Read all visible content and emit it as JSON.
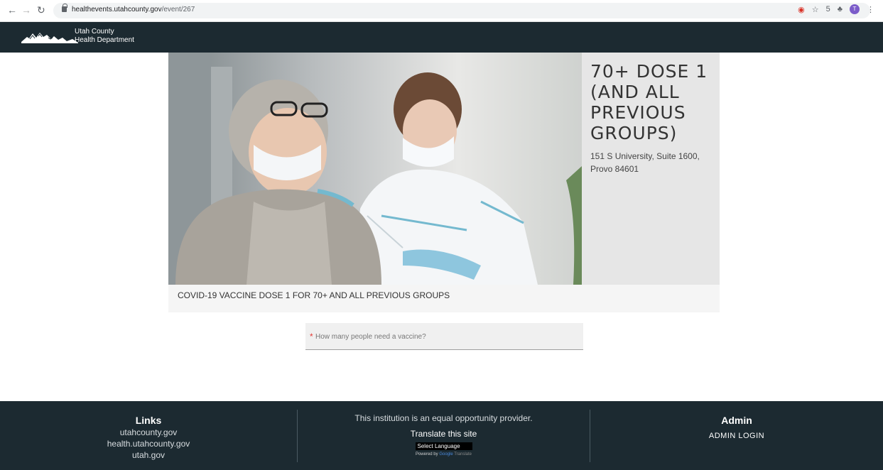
{
  "browser": {
    "url_host": "healthevents.utahcounty.gov",
    "url_path": "/event/267",
    "extension_number": "5",
    "profile_initial": "T"
  },
  "site": {
    "org_line1": "Utah County",
    "org_line2": "Health Department"
  },
  "event": {
    "title": "70+ DOSE 1 (AND ALL PREVIOUS GROUPS)",
    "address": "151 S University, Suite 1600, Provo 84601",
    "description": "COVID-19 VACCINE DOSE 1 FOR 70+ AND ALL PREVIOUS GROUPS"
  },
  "form": {
    "required_mark": "*",
    "people_placeholder": "How many people need a vaccine?"
  },
  "footer": {
    "links_title": "Links",
    "links": [
      "utahcounty.gov",
      "health.utahcounty.gov",
      "utah.gov"
    ],
    "equal_opportunity": "This institution is an equal opportunity provider.",
    "translate_title": "Translate this site",
    "select_language": "Select Language",
    "powered_by": "Powered by",
    "powered_google": "Google",
    "powered_translate": "Translate",
    "admin_title": "Admin",
    "admin_login": "ADMIN LOGIN"
  },
  "colors": {
    "header_bg": "#1c2a31",
    "info_panel_bg": "#e6e6e6",
    "required_red": "#e53935"
  }
}
